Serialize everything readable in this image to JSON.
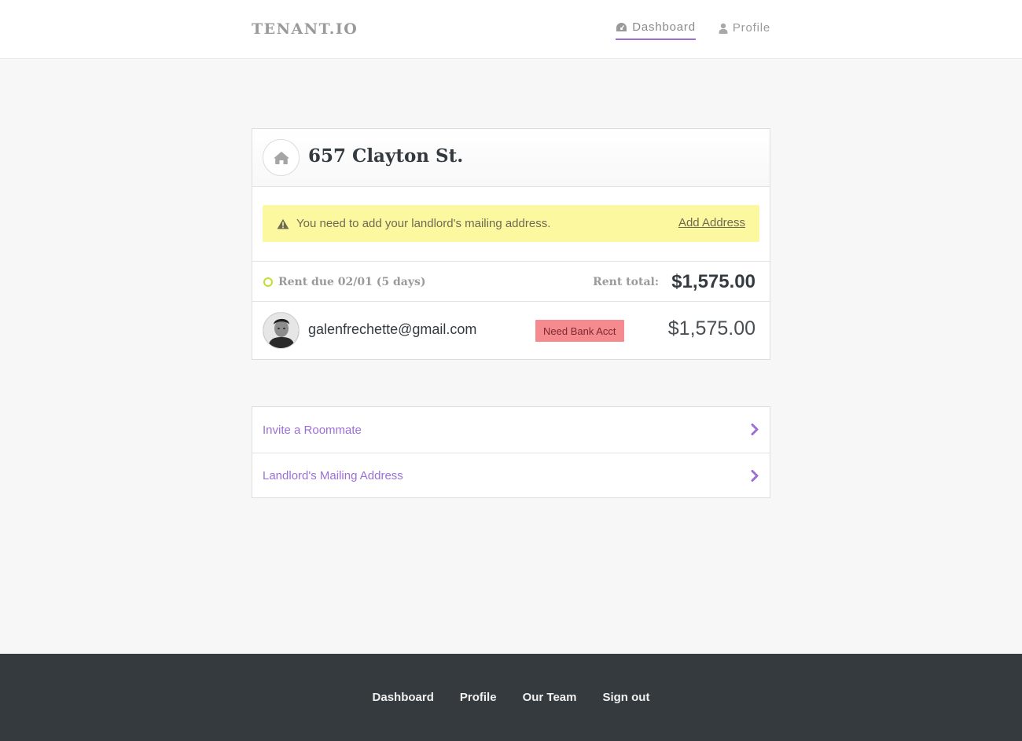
{
  "header": {
    "brand": "TENANT.IO",
    "nav": [
      {
        "label": "Dashboard",
        "icon": "dashboard-gauge-icon",
        "active": true
      },
      {
        "label": "Profile",
        "icon": "user-icon",
        "active": false
      }
    ]
  },
  "property": {
    "icon": "home-icon",
    "address": "657 Clayton St.",
    "alert": {
      "icon": "warning-triangle-icon",
      "message": "You need to add your landlord's mailing address.",
      "action": "Add Address"
    },
    "rent": {
      "status_icon": "circle-outline-icon",
      "due": "Rent due 02/01 (5 days)",
      "total_label": "Rent total:",
      "total_value": "$1,575.00"
    },
    "tenants": [
      {
        "email": "galenfrechette@gmail.com",
        "status": "Need Bank Acct",
        "amount": "$1,575.00"
      }
    ]
  },
  "links": [
    {
      "label": "Invite a Roommate",
      "icon": "chevron-right-icon"
    },
    {
      "label": "Landlord's Mailing Address",
      "icon": "chevron-right-icon"
    }
  ],
  "footer": {
    "links": [
      "Dashboard",
      "Profile",
      "Our Team",
      "Sign out"
    ]
  },
  "colors": {
    "accent": "#9c6fd6",
    "alert_bg": "#fcf8a0",
    "badge_bg": "#f58a8f",
    "footer_bg": "#353a3e",
    "status_dot": "#c4de2c"
  }
}
